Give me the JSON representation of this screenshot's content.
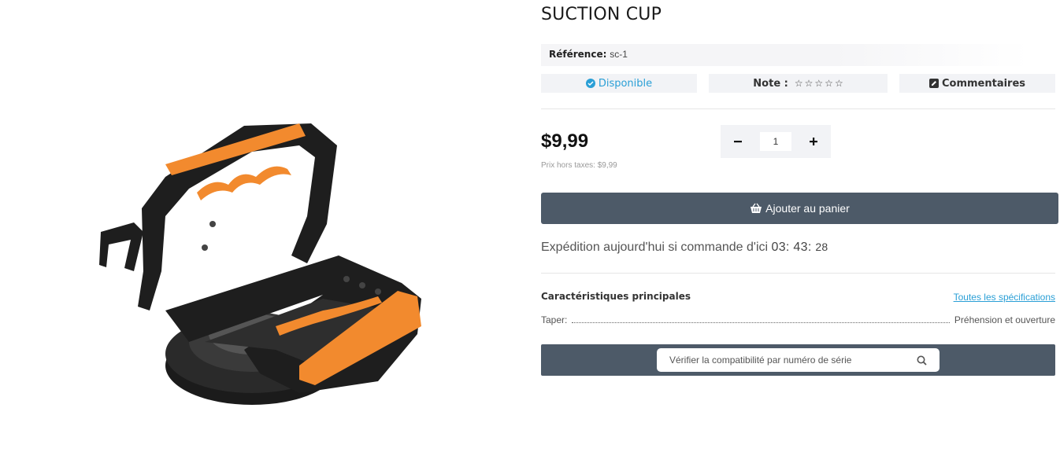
{
  "product": {
    "title": "SUCTION CUP",
    "reference_label": "Référence:",
    "reference_value": "sc-1",
    "availability": "Disponible",
    "note_label": "Note :",
    "rating": 0,
    "rating_max": 5,
    "comments_label": "Commentaires",
    "price": "$9,99",
    "price_ht": "Prix hors taxes: $9,99",
    "quantity": "1",
    "add_to_cart": "Ajouter au panier"
  },
  "shipping": {
    "text": "Expédition aujourd'hui si commande d'ici",
    "hours": "03",
    "minutes": "43",
    "seconds": "28"
  },
  "characteristics": {
    "title": "Caractéristiques principales",
    "all_specs_link": "Toutes les spécifications",
    "rows": [
      {
        "label": "Taper:",
        "value": "Préhension et ouverture"
      }
    ]
  },
  "compatibility": {
    "placeholder": "Vérifier la compatibilité par numéro de série"
  },
  "colors": {
    "accent": "#2a9fd6",
    "button_bg": "#4d5a68",
    "product_orange": "#f28a2e",
    "product_black": "#1e1e1e"
  }
}
